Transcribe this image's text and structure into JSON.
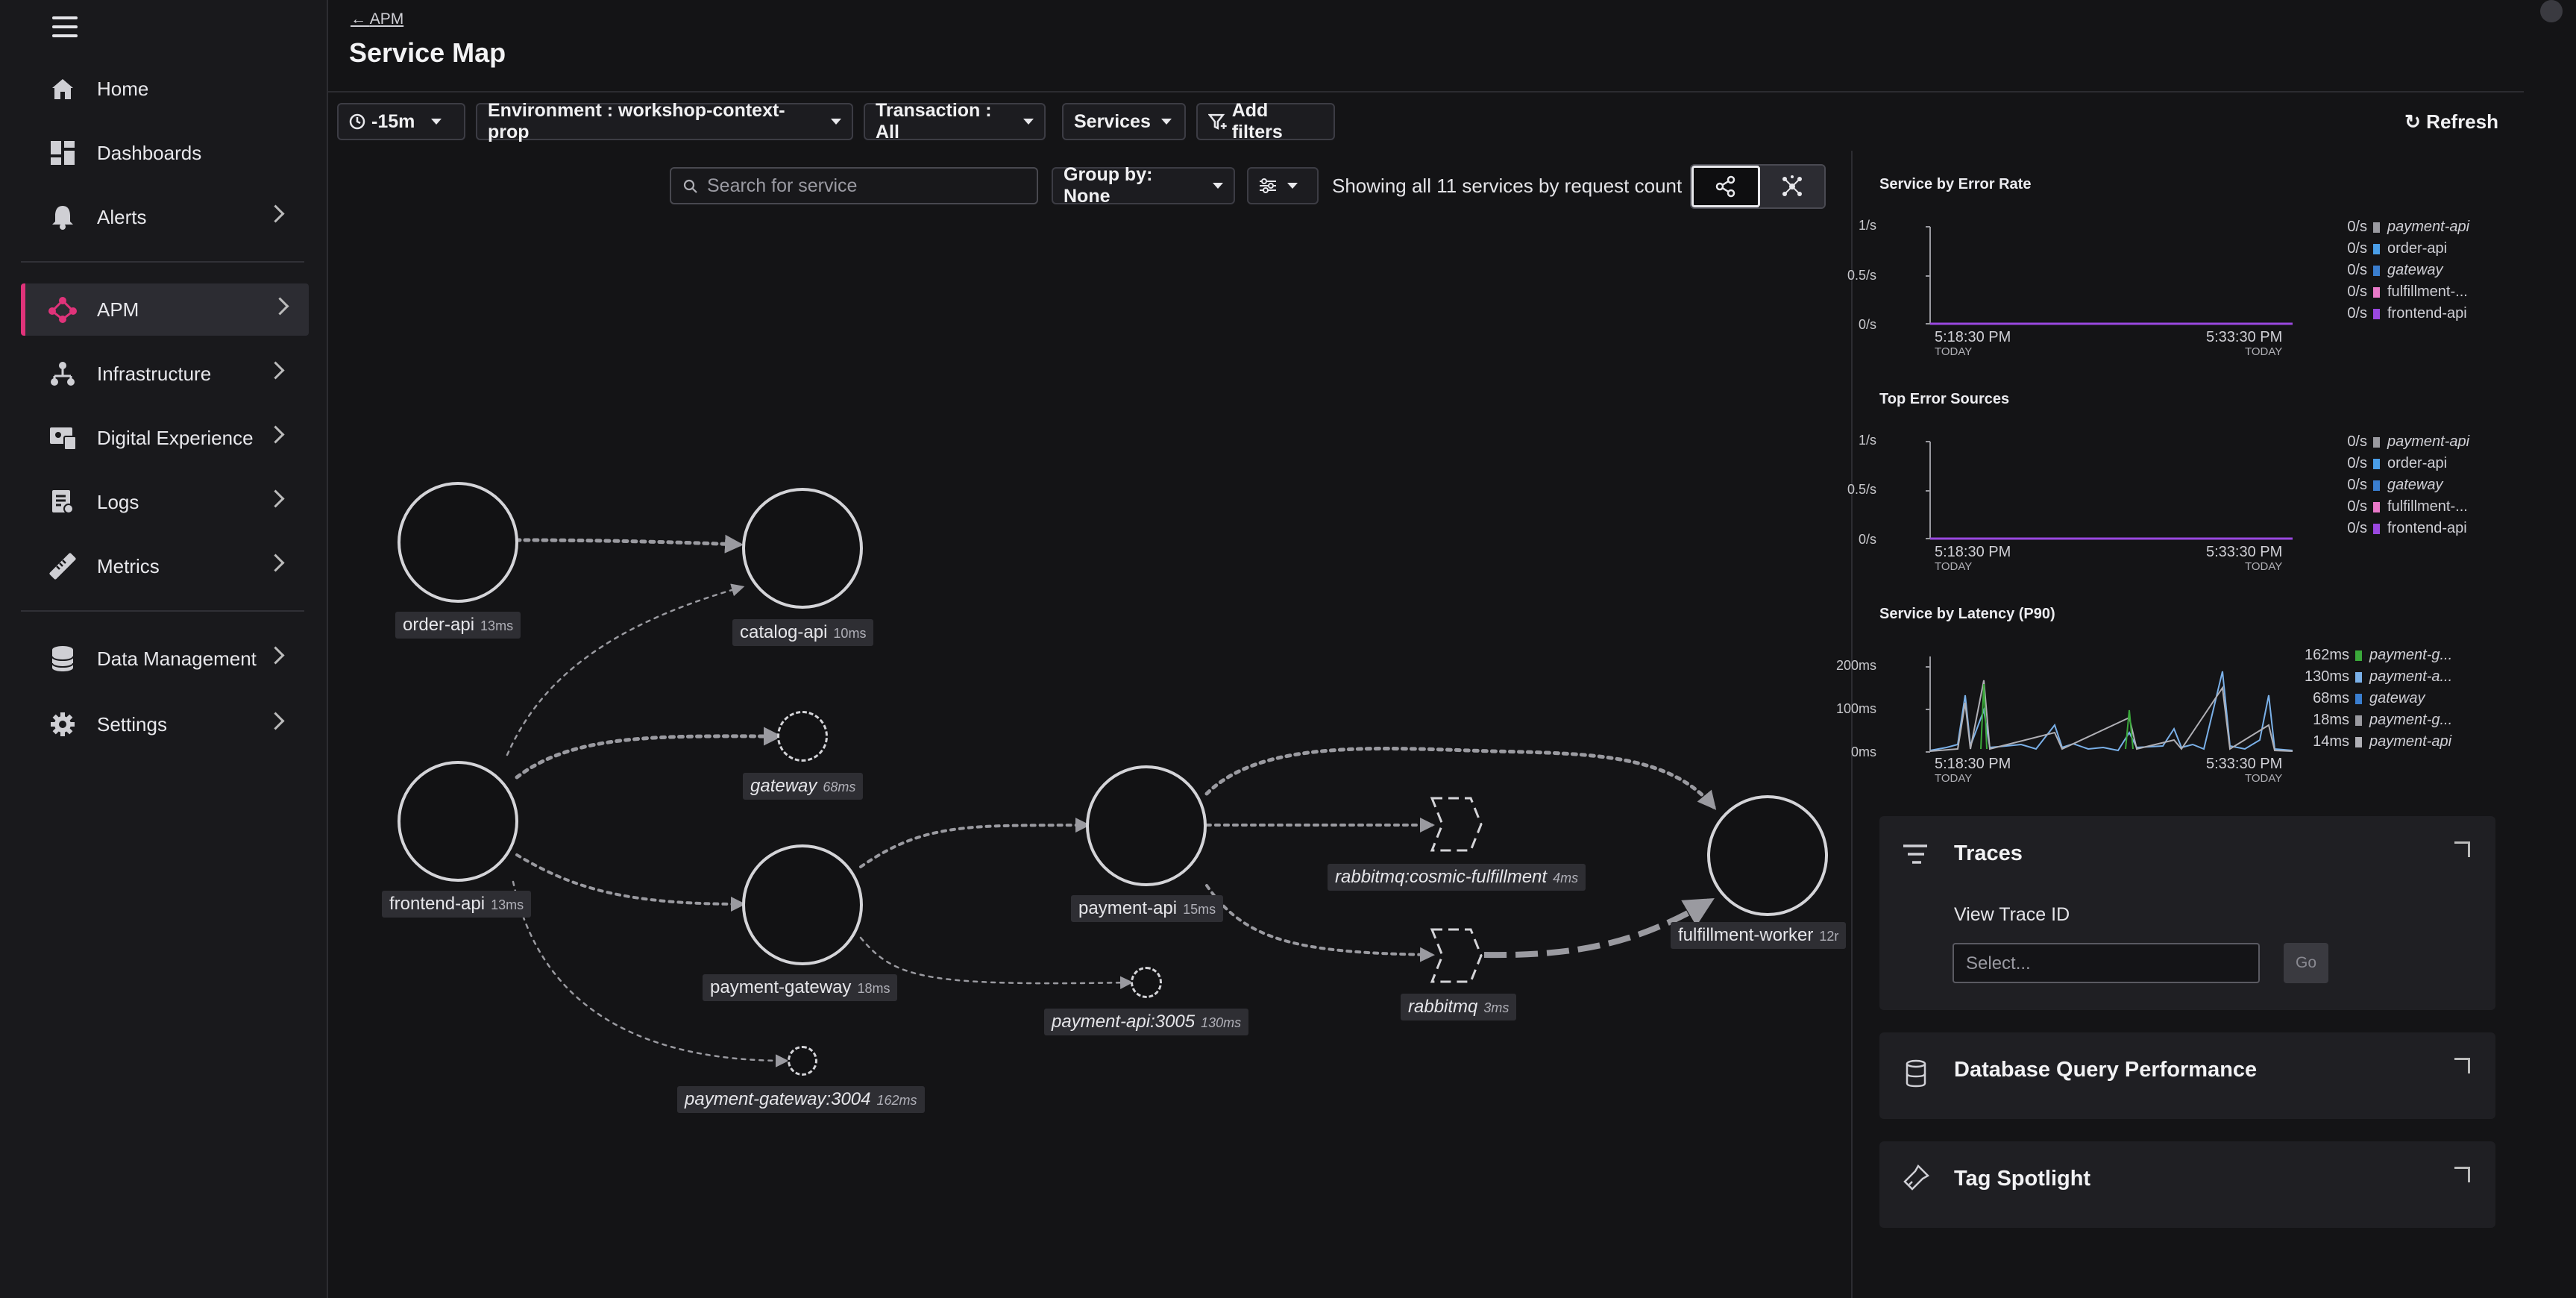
{
  "sidebar": {
    "items": [
      {
        "label": "Home",
        "icon": "home-icon"
      },
      {
        "label": "Dashboards",
        "icon": "dashboards-icon"
      },
      {
        "label": "Alerts",
        "icon": "bell-icon"
      },
      {
        "label": "APM",
        "icon": "apm-icon"
      },
      {
        "label": "Infrastructure",
        "icon": "infrastructure-icon"
      },
      {
        "label": "Digital Experience",
        "icon": "digital-experience-icon"
      },
      {
        "label": "Logs",
        "icon": "logs-icon"
      },
      {
        "label": "Metrics",
        "icon": "metrics-icon"
      },
      {
        "label": "Data Management",
        "icon": "database-icon"
      },
      {
        "label": "Settings",
        "icon": "gear-icon"
      }
    ],
    "accent": "#e0337a"
  },
  "header": {
    "back_label": "APM",
    "title": "Service Map"
  },
  "filters": {
    "time": "-15m",
    "environment": "Environment : workshop-context-prop",
    "transaction": "Transaction : All",
    "services": "Services",
    "add_filters": "Add filters",
    "refresh": "Refresh"
  },
  "map_toolbar": {
    "search_placeholder": "Search for service",
    "group_by": "Group by: None",
    "showing": "Showing all 11 services by request count"
  },
  "nodes": [
    {
      "name": "order-api",
      "ms": "13ms"
    },
    {
      "name": "catalog-api",
      "ms": "10ms"
    },
    {
      "name": "gateway",
      "ms": "68ms"
    },
    {
      "name": "frontend-api",
      "ms": "13ms"
    },
    {
      "name": "payment-gateway",
      "ms": "18ms"
    },
    {
      "name": "payment-api",
      "ms": "15ms"
    },
    {
      "name": "payment-api:3005",
      "ms": "130ms"
    },
    {
      "name": "payment-gateway:3004",
      "ms": "162ms"
    },
    {
      "name": "rabbitmq:cosmic-fulfillment",
      "ms": "4ms"
    },
    {
      "name": "rabbitmq",
      "ms": "3ms"
    },
    {
      "name": "fulfillment-worker",
      "ms": "12r"
    }
  ],
  "charts": {
    "error_rate": {
      "title": "Service by Error Rate",
      "yticks": [
        "1/s",
        "0.5/s",
        "0/s"
      ],
      "x_start": "5:18:30 PM",
      "x_end": "5:33:30 PM",
      "x_sub": "TODAY",
      "legend": [
        {
          "value": "0/s",
          "name": "payment-api",
          "color": "#9a9aa0",
          "italic": true
        },
        {
          "value": "0/s",
          "name": "order-api",
          "color": "#4a9ee8",
          "italic": false
        },
        {
          "value": "0/s",
          "name": "gateway",
          "color": "#3a7ecf",
          "italic": true
        },
        {
          "value": "0/s",
          "name": "fulfillment-...",
          "color": "#e879c8",
          "italic": false
        },
        {
          "value": "0/s",
          "name": "frontend-api",
          "color": "#9a48e0",
          "italic": false
        }
      ]
    },
    "error_sources": {
      "title": "Top Error Sources",
      "yticks": [
        "1/s",
        "0.5/s",
        "0/s"
      ],
      "x_start": "5:18:30 PM",
      "x_end": "5:33:30 PM",
      "x_sub": "TODAY",
      "legend": [
        {
          "value": "0/s",
          "name": "payment-api",
          "color": "#9a9aa0",
          "italic": true
        },
        {
          "value": "0/s",
          "name": "order-api",
          "color": "#4a9ee8",
          "italic": false
        },
        {
          "value": "0/s",
          "name": "gateway",
          "color": "#3a7ecf",
          "italic": true
        },
        {
          "value": "0/s",
          "name": "fulfillment-...",
          "color": "#e879c8",
          "italic": false
        },
        {
          "value": "0/s",
          "name": "frontend-api",
          "color": "#9a48e0",
          "italic": false
        }
      ]
    },
    "latency": {
      "title": "Service by Latency (P90)",
      "yticks": [
        "200ms",
        "100ms",
        "0ms"
      ],
      "x_start": "5:18:30 PM",
      "x_end": "5:33:30 PM",
      "x_sub": "TODAY",
      "legend": [
        {
          "value": "162ms",
          "name": "payment-g...",
          "color": "#3aa83a",
          "italic": true
        },
        {
          "value": "130ms",
          "name": "payment-a...",
          "color": "#7ab0e8",
          "italic": true
        },
        {
          "value": "68ms",
          "name": "gateway",
          "color": "#3a7ecf",
          "italic": true
        },
        {
          "value": "18ms",
          "name": "payment-g...",
          "color": "#9a9aa0",
          "italic": true
        },
        {
          "value": "14ms",
          "name": "payment-api",
          "color": "#b0b0b6",
          "italic": true
        }
      ]
    }
  },
  "traces": {
    "title": "Traces",
    "view_label": "View Trace ID",
    "placeholder": "Select...",
    "go": "Go"
  },
  "db_card": {
    "title": "Database Query Performance"
  },
  "tag_card": {
    "title": "Tag Spotlight"
  }
}
